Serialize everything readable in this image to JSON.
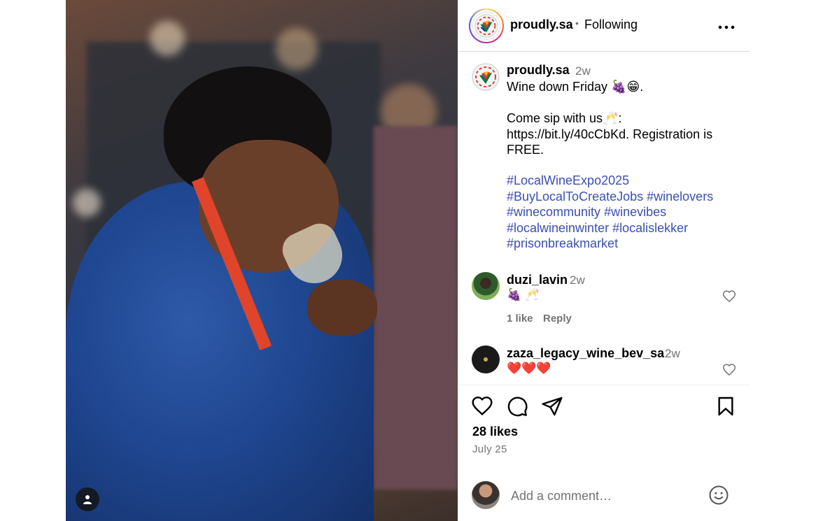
{
  "post": {
    "author": "proudly.sa",
    "follow_separator": "•",
    "follow_state": "Following",
    "more_label": "•••",
    "photo_alt": "Man in blue blazer smiling while holding a wine glass labelled LOCAL WINE"
  },
  "caption": {
    "author": "proudly.sa",
    "time": "2w",
    "text": "Wine down Friday 🍇😁.\n\nCome sip with us🥂:\nhttps://bit.ly/40cCbKd. Registration is FREE.",
    "hashtags": [
      "#LocalWineExpo2025",
      "#BuyLocalToCreateJobs",
      "#winelovers",
      "#winecommunity",
      "#winevibes",
      "#localwineinwinter",
      "#localislekker",
      "#prisonbreakmarket"
    ]
  },
  "comments": [
    {
      "author": "duzi_lavin",
      "time": "2w",
      "text": "🍇 🥂",
      "likes": "1 like",
      "reply": "Reply"
    },
    {
      "author": "zaza_legacy_wine_bev_sa",
      "time": "2w",
      "text": "❤️❤️❤️"
    }
  ],
  "stats": {
    "likes": "28 likes",
    "date": "July 25"
  },
  "add_comment": {
    "placeholder": "Add a comment…"
  },
  "icons": {
    "more": "more-options-icon",
    "like": "heart-icon",
    "comment": "comment-bubble-icon",
    "share": "paper-plane-icon",
    "save": "bookmark-icon",
    "emoji": "emoji-smile-icon",
    "user_tag": "user-tag-icon"
  },
  "colors": {
    "hashtag": "#3a4fb3",
    "muted": "#737373",
    "border": "#dbdbdb"
  }
}
